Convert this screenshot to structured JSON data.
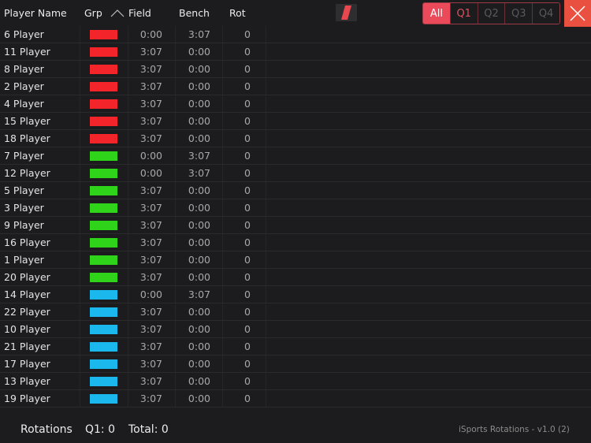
{
  "header": {
    "player_name": "Player Name",
    "grp": "Grp",
    "field": "Field",
    "bench": "Bench",
    "rot": "Rot"
  },
  "groups": {
    "red": "#f4252a",
    "green": "#2fd41a",
    "blue": "#1ab8ec"
  },
  "players": [
    {
      "name": "6 Player",
      "group": "red",
      "field": "0:00",
      "bench": "3:07",
      "rot": "0"
    },
    {
      "name": "11 Player",
      "group": "red",
      "field": "3:07",
      "bench": "0:00",
      "rot": "0"
    },
    {
      "name": "8 Player",
      "group": "red",
      "field": "3:07",
      "bench": "0:00",
      "rot": "0"
    },
    {
      "name": "2 Player",
      "group": "red",
      "field": "3:07",
      "bench": "0:00",
      "rot": "0"
    },
    {
      "name": "4 Player",
      "group": "red",
      "field": "3:07",
      "bench": "0:00",
      "rot": "0"
    },
    {
      "name": "15 Player",
      "group": "red",
      "field": "3:07",
      "bench": "0:00",
      "rot": "0"
    },
    {
      "name": "18 Player",
      "group": "red",
      "field": "3:07",
      "bench": "0:00",
      "rot": "0"
    },
    {
      "name": "7 Player",
      "group": "green",
      "field": "0:00",
      "bench": "3:07",
      "rot": "0"
    },
    {
      "name": "12 Player",
      "group": "green",
      "field": "0:00",
      "bench": "3:07",
      "rot": "0"
    },
    {
      "name": "5 Player",
      "group": "green",
      "field": "3:07",
      "bench": "0:00",
      "rot": "0"
    },
    {
      "name": "3 Player",
      "group": "green",
      "field": "3:07",
      "bench": "0:00",
      "rot": "0"
    },
    {
      "name": "9 Player",
      "group": "green",
      "field": "3:07",
      "bench": "0:00",
      "rot": "0"
    },
    {
      "name": "16 Player",
      "group": "green",
      "field": "3:07",
      "bench": "0:00",
      "rot": "0"
    },
    {
      "name": "1 Player",
      "group": "green",
      "field": "3:07",
      "bench": "0:00",
      "rot": "0"
    },
    {
      "name": "20 Player",
      "group": "green",
      "field": "3:07",
      "bench": "0:00",
      "rot": "0"
    },
    {
      "name": "14 Player",
      "group": "blue",
      "field": "0:00",
      "bench": "3:07",
      "rot": "0"
    },
    {
      "name": "22 Player",
      "group": "blue",
      "field": "3:07",
      "bench": "0:00",
      "rot": "0"
    },
    {
      "name": "10 Player",
      "group": "blue",
      "field": "3:07",
      "bench": "0:00",
      "rot": "0"
    },
    {
      "name": "21 Player",
      "group": "blue",
      "field": "3:07",
      "bench": "0:00",
      "rot": "0"
    },
    {
      "name": "17 Player",
      "group": "blue",
      "field": "3:07",
      "bench": "0:00",
      "rot": "0"
    },
    {
      "name": "13 Player",
      "group": "blue",
      "field": "3:07",
      "bench": "0:00",
      "rot": "0"
    },
    {
      "name": "19 Player",
      "group": "blue",
      "field": "3:07",
      "bench": "0:00",
      "rot": "0"
    }
  ],
  "quarters": {
    "selected": "All",
    "current": "Q1",
    "options": [
      "All",
      "Q1",
      "Q2",
      "Q3",
      "Q4"
    ]
  },
  "icons": {
    "sort": "chevron-up-icon",
    "logo": "app-logo-slash",
    "close": "close-icon"
  },
  "colors": {
    "accent": "#ea4a5a",
    "close": "#e9503f",
    "background": "#1c1b1d"
  },
  "footer": {
    "rotations_label": "Rotations",
    "q1": "Q1: 0",
    "total": "Total: 0",
    "version": "iSports Rotations - v1.0 (2)"
  }
}
